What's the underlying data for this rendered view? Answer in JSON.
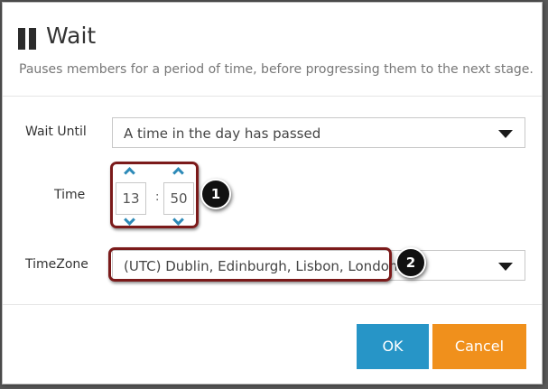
{
  "dialog": {
    "title": "Wait",
    "subtitle": "Pauses members for a period of time, before progressing them to the next stage."
  },
  "form": {
    "wait_until_label": "Wait Until",
    "wait_until_value": "A time in the day has passed",
    "time_label": "Time",
    "time_hour": "13",
    "time_separator": ":",
    "time_minute": "50",
    "timezone_label": "TimeZone",
    "timezone_value": "(UTC) Dublin, Edinburgh, Lisbon, London"
  },
  "annotations": {
    "badge_1": "1",
    "badge_2": "2"
  },
  "buttons": {
    "ok": "OK",
    "cancel": "Cancel"
  },
  "colors": {
    "primary": "#2795c7",
    "cancel": "#f0901c",
    "annotation": "#7b1a1a",
    "chevron": "#2d8ab8"
  },
  "icons": [
    "pause-icon",
    "chevron-up-icon",
    "chevron-down-icon",
    "dropdown-caret-icon"
  ]
}
